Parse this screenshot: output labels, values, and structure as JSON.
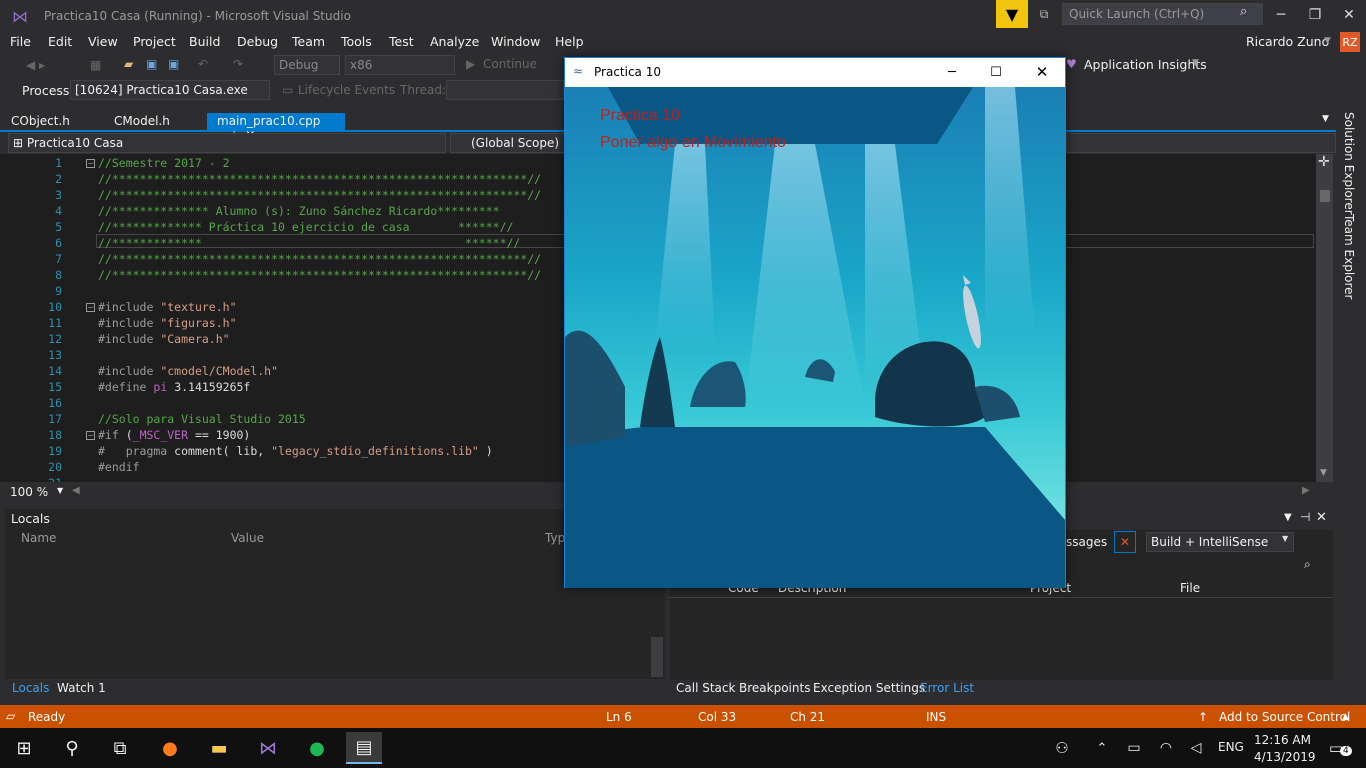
{
  "window": {
    "title": "Practica10 Casa (Running) - Microsoft Visual Studio",
    "quick_launch": "Quick Launch (Ctrl+Q)"
  },
  "menu": [
    "File",
    "Edit",
    "View",
    "Project",
    "Build",
    "Debug",
    "Team",
    "Tools",
    "Test",
    "Analyze",
    "Window",
    "Help"
  ],
  "user": {
    "name": "Ricardo Zuno",
    "initials": "RZ"
  },
  "toolbar": {
    "config": "Debug",
    "platform": "x86",
    "continue": "Continue",
    "app_insights": "Application Insights",
    "process_label": "Process:",
    "process_value": "[10624] Practica10 Casa.exe",
    "lifecycle": "Lifecycle Events",
    "thread_label": "Thread:"
  },
  "tabs": [
    {
      "label": "CObject.h"
    },
    {
      "label": "CModel.h"
    },
    {
      "label": "main_prac10.cpp"
    }
  ],
  "nav": {
    "project": "Practica10 Casa",
    "scope": "(Global Scope)"
  },
  "editor": {
    "zoom": "100 %",
    "lines": [
      {
        "n": "1",
        "t": "//Semestre 2017 - 2"
      },
      {
        "n": "2",
        "t": "//************************************************************//"
      },
      {
        "n": "3",
        "t": "//************************************************************//"
      },
      {
        "n": "4",
        "t": "//************** Alumno (s): Zuno Sánchez Ricardo*********"
      },
      {
        "n": "5",
        "t": "//************* Práctica 10 ejercicio de casa       ******//"
      },
      {
        "n": "6",
        "t": "//*************                                      ******//"
      },
      {
        "n": "7",
        "t": "//************************************************************//"
      },
      {
        "n": "8",
        "t": "//************************************************************//"
      },
      {
        "n": "9",
        "t": ""
      },
      {
        "n": "10",
        "t": "#include \"texture.h\""
      },
      {
        "n": "11",
        "t": "#include \"figuras.h\""
      },
      {
        "n": "12",
        "t": "#include \"Camera.h\""
      },
      {
        "n": "13",
        "t": ""
      },
      {
        "n": "14",
        "t": "#include \"cmodel/CModel.h\""
      },
      {
        "n": "15",
        "t": "#define pi 3.14159265f"
      },
      {
        "n": "16",
        "t": ""
      },
      {
        "n": "17",
        "t": "//Solo para Visual Studio 2015"
      },
      {
        "n": "18",
        "t": "#if (_MSC_VER == 1900)"
      },
      {
        "n": "19",
        "t": "#   pragma comment( lib, \"legacy_stdio_definitions.lib\" )"
      },
      {
        "n": "20",
        "t": "#endif"
      },
      {
        "n": "21",
        "t": ""
      }
    ]
  },
  "locals": {
    "title": "Locals",
    "col_name": "Name",
    "col_value": "Value",
    "col_type": "Typ"
  },
  "errors": {
    "messages": "ssages",
    "filter": "Build + IntelliSense",
    "col_code": "Code",
    "col_desc": "Description",
    "col_project": "Project",
    "col_file": "File"
  },
  "bottom_tabs_left": [
    "Locals",
    "Watch 1"
  ],
  "bottom_tabs_right": [
    "Call Stack",
    "Breakpoints",
    "Exception Settings",
    "Error List"
  ],
  "status": {
    "ready": "Ready",
    "ln": "Ln 6",
    "col": "Col 33",
    "ch": "Ch 21",
    "ins": "INS",
    "source": "Add to Source Control"
  },
  "taskbar": {
    "lang": "ENG",
    "time": "12:16 AM",
    "date": "4/13/2019",
    "notif": "4"
  },
  "app": {
    "title": "Practica 10",
    "line1": "Practica 10",
    "line2": "Poner algo en Movimiento"
  },
  "colors": {
    "accent": "#007acc",
    "status": "#ca5100",
    "scene_text": "#c0201a"
  }
}
